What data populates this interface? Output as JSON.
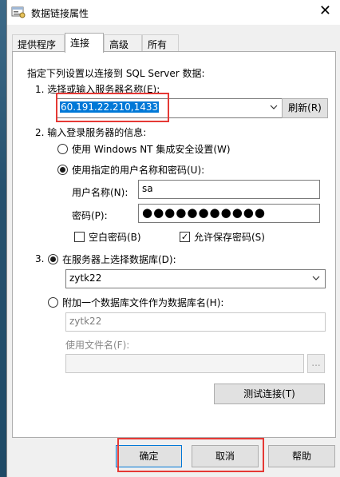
{
  "window": {
    "title": "数据链接属性",
    "close_glyph": "✕"
  },
  "tabs": [
    {
      "label": "提供程序",
      "active": false
    },
    {
      "label": "连接",
      "active": true
    },
    {
      "label": "高级",
      "active": false
    },
    {
      "label": "所有",
      "active": false
    }
  ],
  "connection": {
    "intro": "指定下列设置以连接到 SQL Server 数据:",
    "step1_label": "1. 选择或输入服务器名称(E):",
    "server_name": "60.191.22.210,1433",
    "refresh_button": "刷新(R)",
    "step2_label": "2. 输入登录服务器的信息:",
    "auth_windows": "使用 Windows NT 集成安全设置(W)",
    "auth_specific": "使用指定的用户名称和密码(U):",
    "username_label": "用户名称(N):",
    "username_value": "sa",
    "password_label": "密码(P):",
    "password_mask": "●●●●●●●●●●●",
    "blank_password": "空白密码(B)",
    "allow_save_password": "允许保存密码(S)",
    "checkmark": "✓",
    "step3_prefix": "3.",
    "db_on_server": "在服务器上选择数据库(D):",
    "database_value": "zytk22",
    "attach_db": "附加一个数据库文件作为数据库名(H):",
    "attach_db_value": "zytk22",
    "use_filename_label": "使用文件名(F):",
    "browse_button": "...",
    "test_button": "测试连接(T)"
  },
  "footer": {
    "ok": "确定",
    "cancel": "取消",
    "help": "帮助"
  },
  "colors": {
    "highlight_border": "#e53935",
    "selection": "#0078d7"
  },
  "icons": [
    "app-icon",
    "close-icon",
    "chevron-down-icon"
  ]
}
